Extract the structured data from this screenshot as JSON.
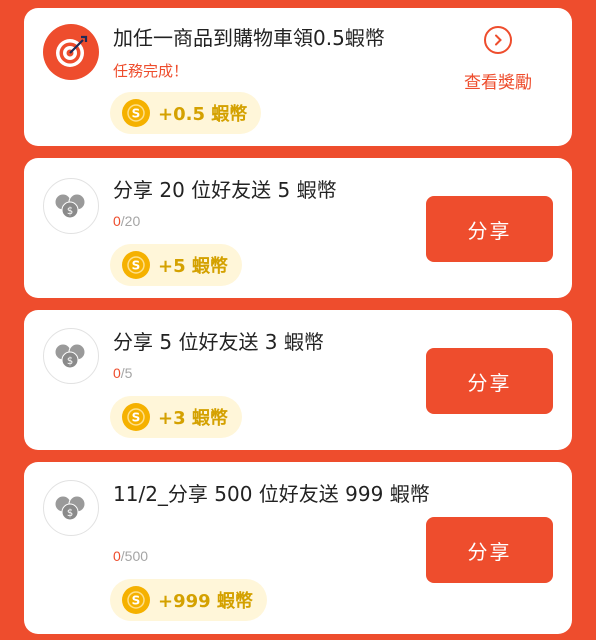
{
  "colors": {
    "background": "#ee4d2d",
    "card": "#ffffff",
    "accent": "#ee4d2d",
    "coin": "#f5b100",
    "reward_pill": "#fff6d9",
    "reward_text": "#d4a100"
  },
  "tasks": [
    {
      "icon": "target-icon",
      "title": "加任一商品到購物車領0.5蝦幣",
      "status": "任務完成！",
      "reward": "+0.5 蝦幣",
      "action_label": "查看獎勵"
    },
    {
      "icon": "coins-icon",
      "title": "分享 20 位好友送 5 蝦幣",
      "progress_current": "0",
      "progress_total": "/20",
      "reward": "+5 蝦幣",
      "action_label": "分享"
    },
    {
      "icon": "coins-icon",
      "title": "分享 5 位好友送 3 蝦幣",
      "progress_current": "0",
      "progress_total": "/5",
      "reward": "+3 蝦幣",
      "action_label": "分享"
    },
    {
      "icon": "coins-icon",
      "title": "11/2_分享 500 位好友送 999 蝦幣",
      "progress_current": "0",
      "progress_total": "/500",
      "reward": "+999 蝦幣",
      "action_label": "分享"
    }
  ]
}
